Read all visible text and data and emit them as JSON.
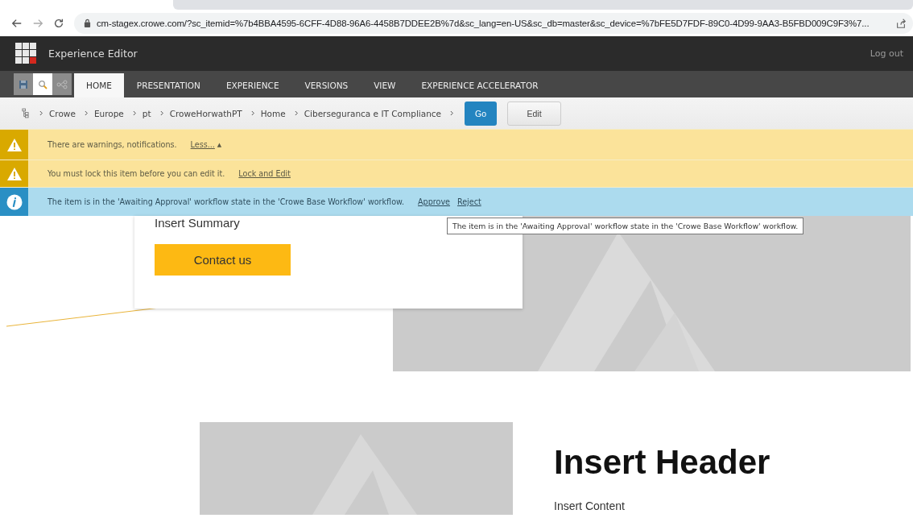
{
  "browser": {
    "url": "cm-stagex.crowe.com/?sc_itemid=%7b4BBA4595-6CFF-4D88-96A6-4458B7DDEE2B%7d&sc_lang=en-US&sc_db=master&sc_device=%7bFE5D7FDF-89C0-4D99-9AA3-B5FBD009C9F3%7..."
  },
  "app_bar": {
    "title": "Experience Editor",
    "logout": "Log out"
  },
  "ribbon": {
    "tabs": [
      {
        "label": "HOME",
        "selected": true
      },
      {
        "label": "PRESENTATION",
        "selected": false
      },
      {
        "label": "EXPERIENCE",
        "selected": false
      },
      {
        "label": "VERSIONS",
        "selected": false
      },
      {
        "label": "VIEW",
        "selected": false
      },
      {
        "label": "EXPERIENCE ACCELERATOR",
        "selected": false
      }
    ]
  },
  "breadcrumb": {
    "items": [
      "Crowe",
      "Europe",
      "pt",
      "CroweHorwathPT",
      "Home",
      "Ciberseguranca e IT Compliance"
    ],
    "go": "Go",
    "edit": "Edit"
  },
  "notifications": [
    {
      "kind": "warning",
      "text": "There are warnings, notifications.",
      "links": [
        "Less..."
      ],
      "caret": "▲"
    },
    {
      "kind": "warning",
      "text": "You must lock this item before you can edit it.",
      "links": [
        "Lock and Edit"
      ]
    },
    {
      "kind": "info",
      "text": "The item is in the 'Awaiting Approval' workflow state in the 'Crowe Base Workflow' workflow.",
      "links": [
        "Approve",
        "Reject"
      ]
    }
  ],
  "tooltip": "The item is in the 'Awaiting Approval' workflow state in the 'Crowe Base Workflow' workflow.",
  "card": {
    "summary": "Insert Summary",
    "button": "Contact us"
  },
  "section": {
    "header": "Insert Header",
    "content": "Insert Content"
  }
}
